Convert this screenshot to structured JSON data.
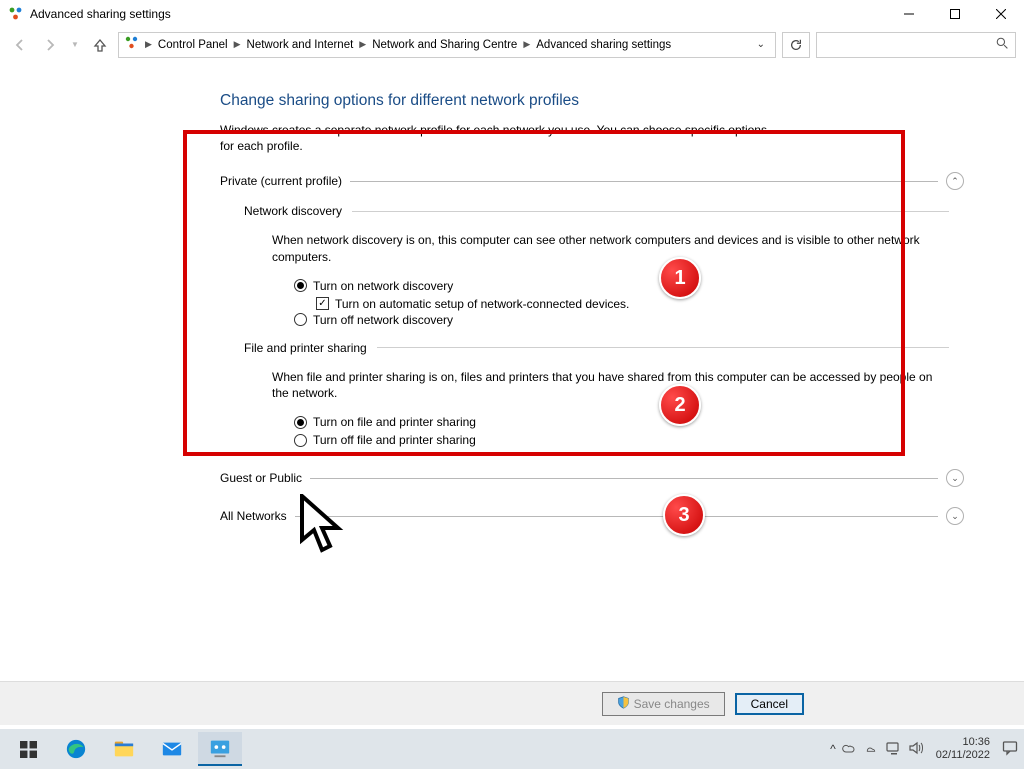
{
  "window": {
    "title": "Advanced sharing settings"
  },
  "breadcrumbs": {
    "a": "Control Panel",
    "b": "Network and Internet",
    "c": "Network and Sharing Centre",
    "d": "Advanced sharing settings"
  },
  "page": {
    "title": "Change sharing options for different network profiles",
    "desc": "Windows creates a separate network profile for each network you use. You can choose specific options for each profile."
  },
  "profiles": {
    "private": {
      "label": "Private (current profile)"
    },
    "guest": {
      "label": "Guest or Public"
    },
    "all": {
      "label": "All Networks"
    }
  },
  "netdisc": {
    "head": "Network discovery",
    "desc": "When network discovery is on, this computer can see other network computers and devices and is visible to other network computers.",
    "on": "Turn on network discovery",
    "auto": "Turn on automatic setup of network-connected devices.",
    "off": "Turn off network discovery"
  },
  "fps": {
    "head": "File and printer sharing",
    "desc": "When file and printer sharing is on, files and printers that you have shared from this computer can be accessed by people on the network.",
    "on": "Turn on file and printer sharing",
    "off": "Turn off file and printer sharing"
  },
  "buttons": {
    "save": "Save changes",
    "cancel": "Cancel"
  },
  "clock": {
    "time": "10:36",
    "date": "02/11/2022"
  },
  "callouts": {
    "c1": "1",
    "c2": "2",
    "c3": "3"
  }
}
